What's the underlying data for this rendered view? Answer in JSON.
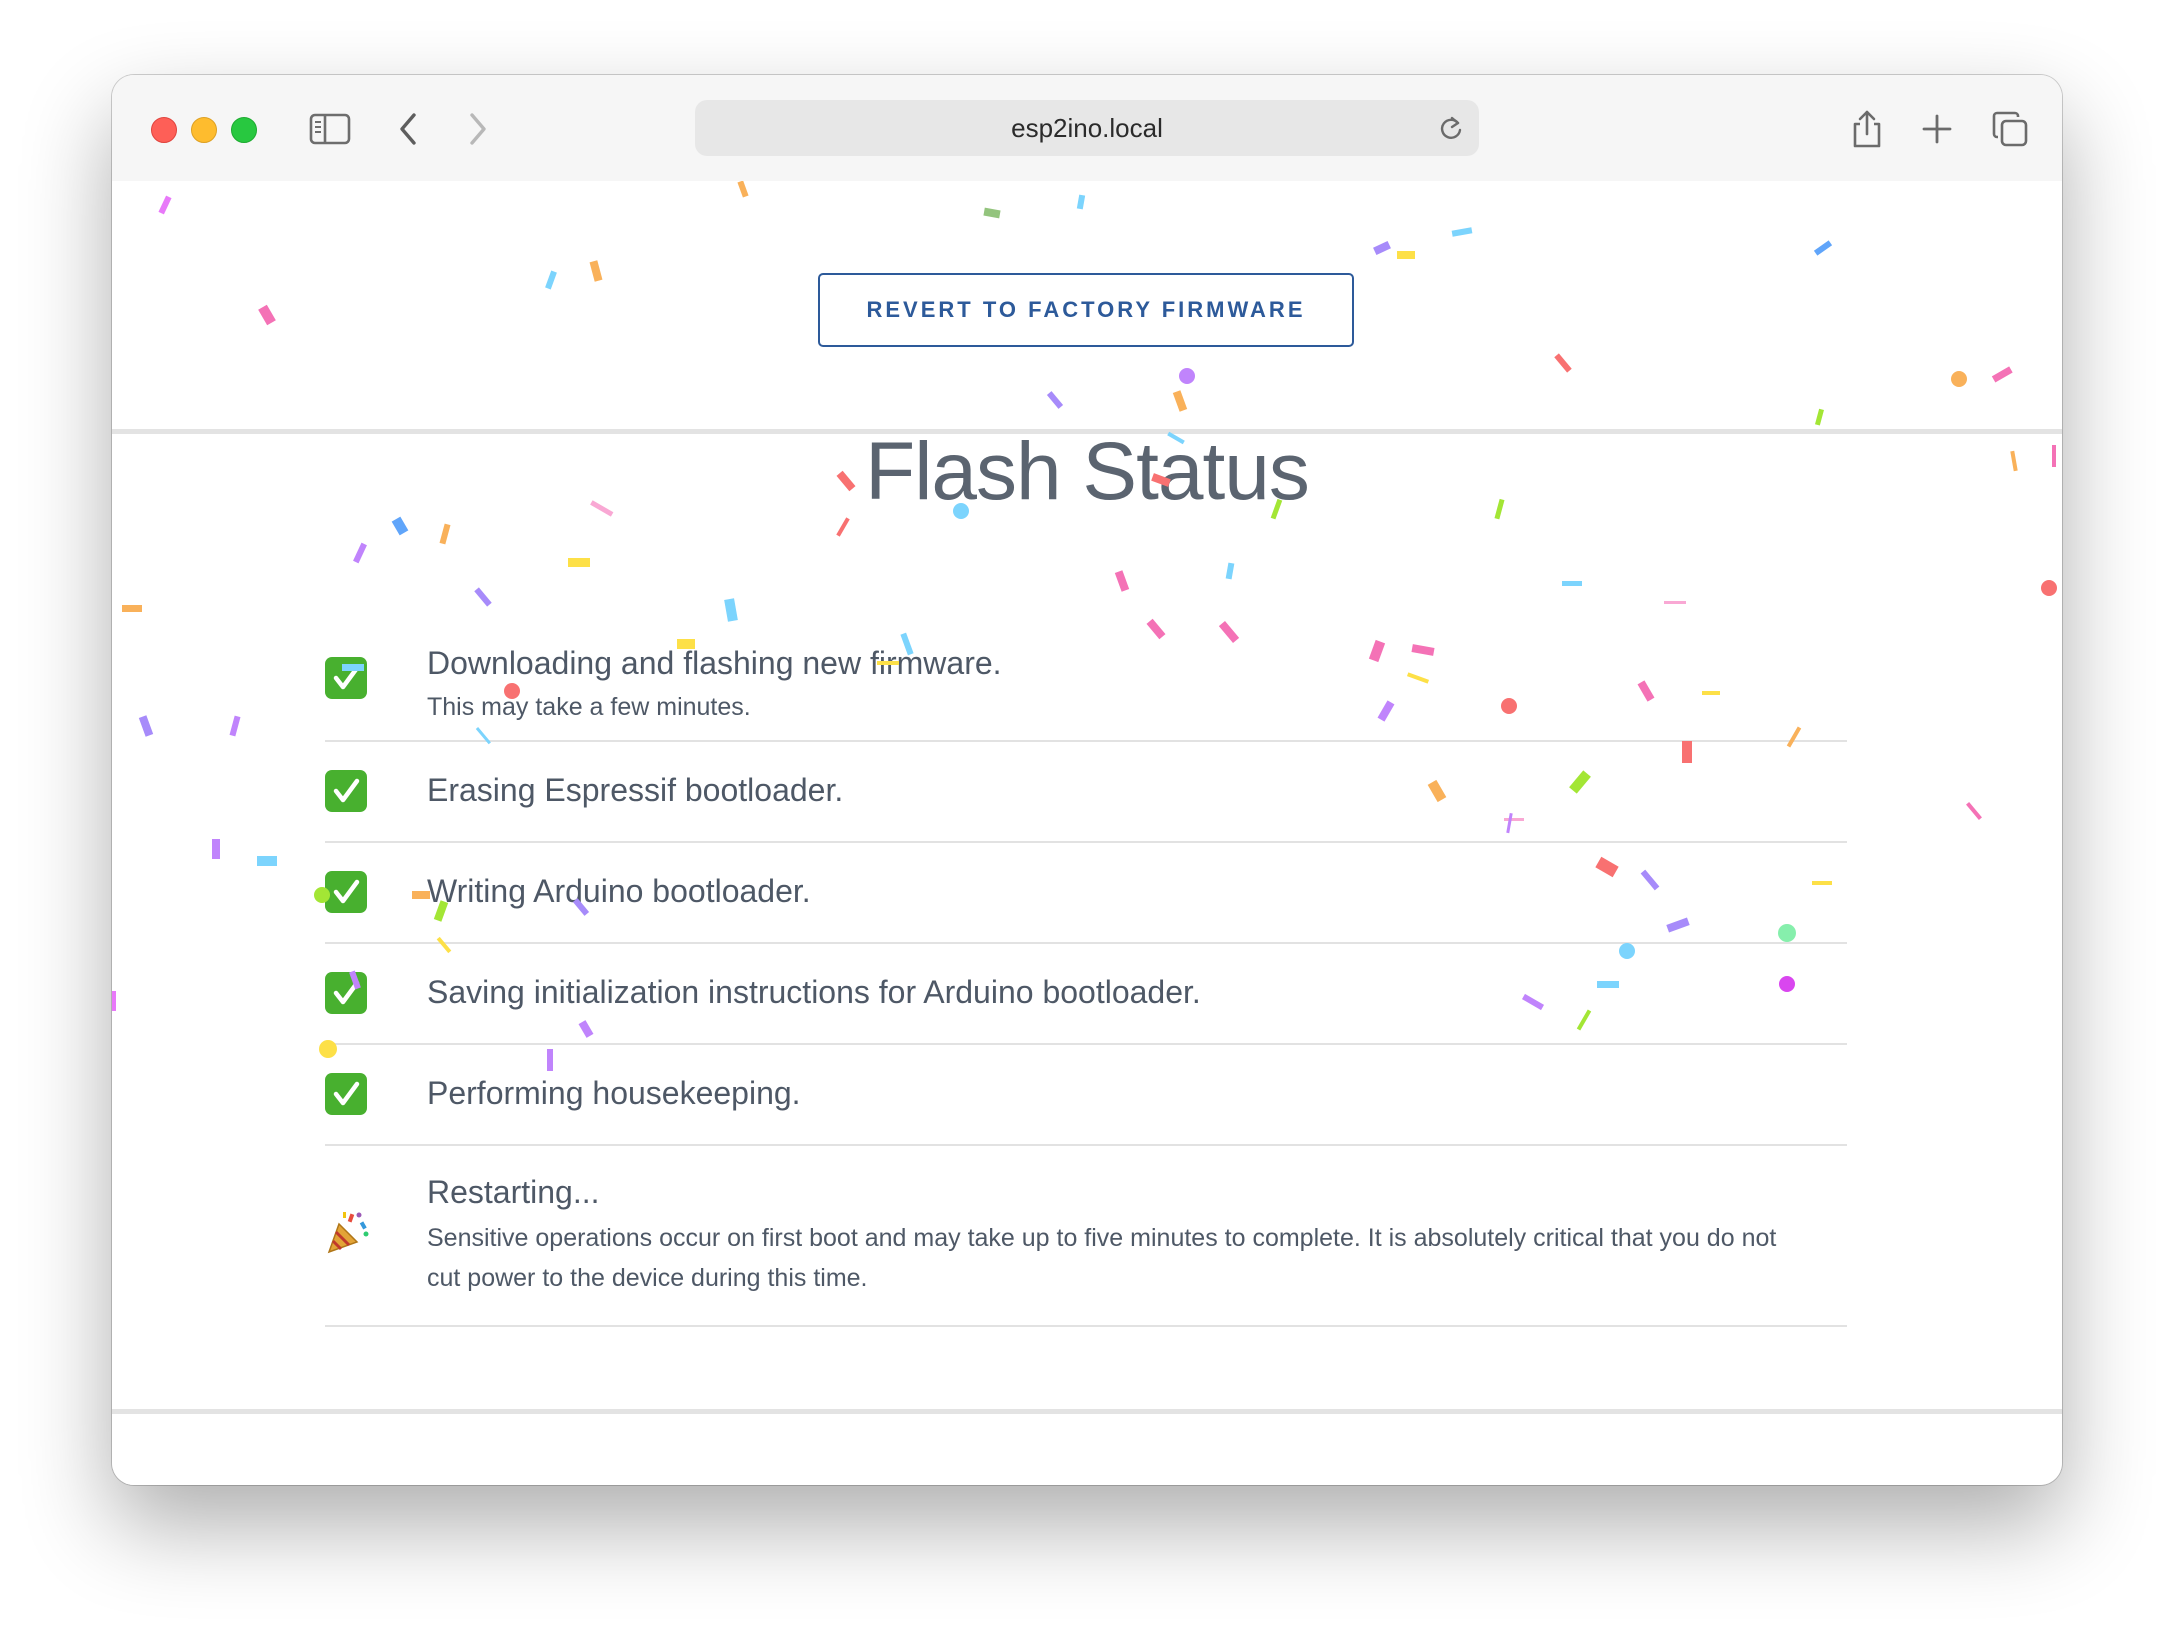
{
  "browser": {
    "url": "esp2ino.local"
  },
  "page": {
    "revert_button_label": "REVERT TO FACTORY FIRMWARE",
    "title": "Flash Status",
    "steps": [
      {
        "status": "done",
        "icon": "checkmark-icon",
        "title": "Downloading and flashing new firmware.",
        "detail": "This may take a few minutes."
      },
      {
        "status": "done",
        "icon": "checkmark-icon",
        "title": "Erasing Espressif bootloader."
      },
      {
        "status": "done",
        "icon": "checkmark-icon",
        "title": "Writing Arduino bootloader."
      },
      {
        "status": "done",
        "icon": "checkmark-icon",
        "title": "Saving initialization instructions for Arduino bootloader."
      },
      {
        "status": "done",
        "icon": "checkmark-icon",
        "title": "Performing housekeeping."
      },
      {
        "status": "celebrate",
        "icon": "party-popper-icon",
        "title": "Restarting...",
        "detail": "Sensitive operations occur on first boot and may take up to five minutes to complete. It is absolutely critical that you do not cut power to the device during this time."
      }
    ]
  },
  "colors": {
    "accent": "#2d5a9a",
    "check_green": "#48b02f",
    "title_gray": "#5b6470"
  }
}
